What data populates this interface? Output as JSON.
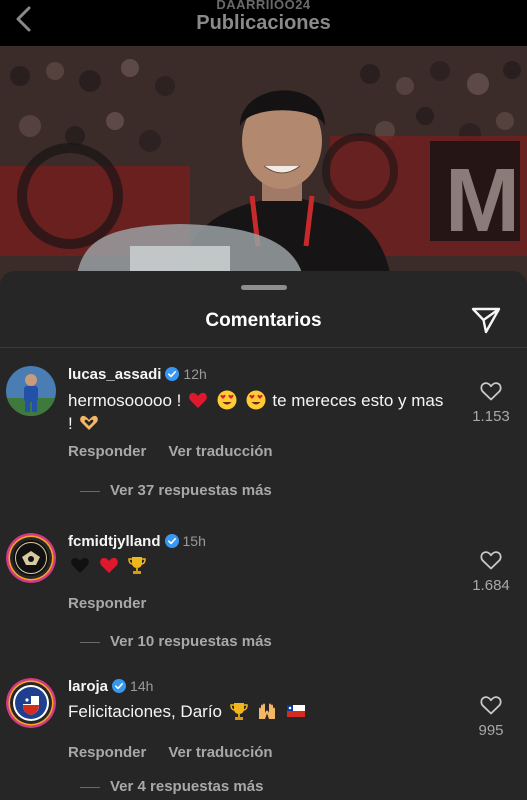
{
  "header": {
    "username": "DAARRIIOO24",
    "title": "Publicaciones"
  },
  "sheet": {
    "title": "Comentarios"
  },
  "comments": [
    {
      "username": "lucas_assadi",
      "time": "12h",
      "text_before": "hermosooooo !",
      "text_middle": "te mereces esto y",
      "text_after": "mas !",
      "actions": [
        "Responder",
        "Ver traducción"
      ],
      "replies": "Ver 37 respuestas más",
      "likes": "1.153"
    },
    {
      "username": "fcmidtjylland",
      "time": "15h",
      "actions": [
        "Responder"
      ],
      "replies": "Ver 10 respuestas más",
      "likes": "1.684"
    },
    {
      "username": "laroja",
      "time": "14h",
      "text_before": "Felicitaciones, Darío",
      "actions": [
        "Responder",
        "Ver traducción"
      ],
      "replies": "Ver 4 respuestas más",
      "likes": "995"
    }
  ],
  "colors": {
    "sheet_bg": "#262626",
    "verified": "#3897f0",
    "heart_red": "#e0182d"
  },
  "icons": [
    "back-icon",
    "send-icon",
    "heart-outline-icon",
    "verified-badge-icon"
  ]
}
